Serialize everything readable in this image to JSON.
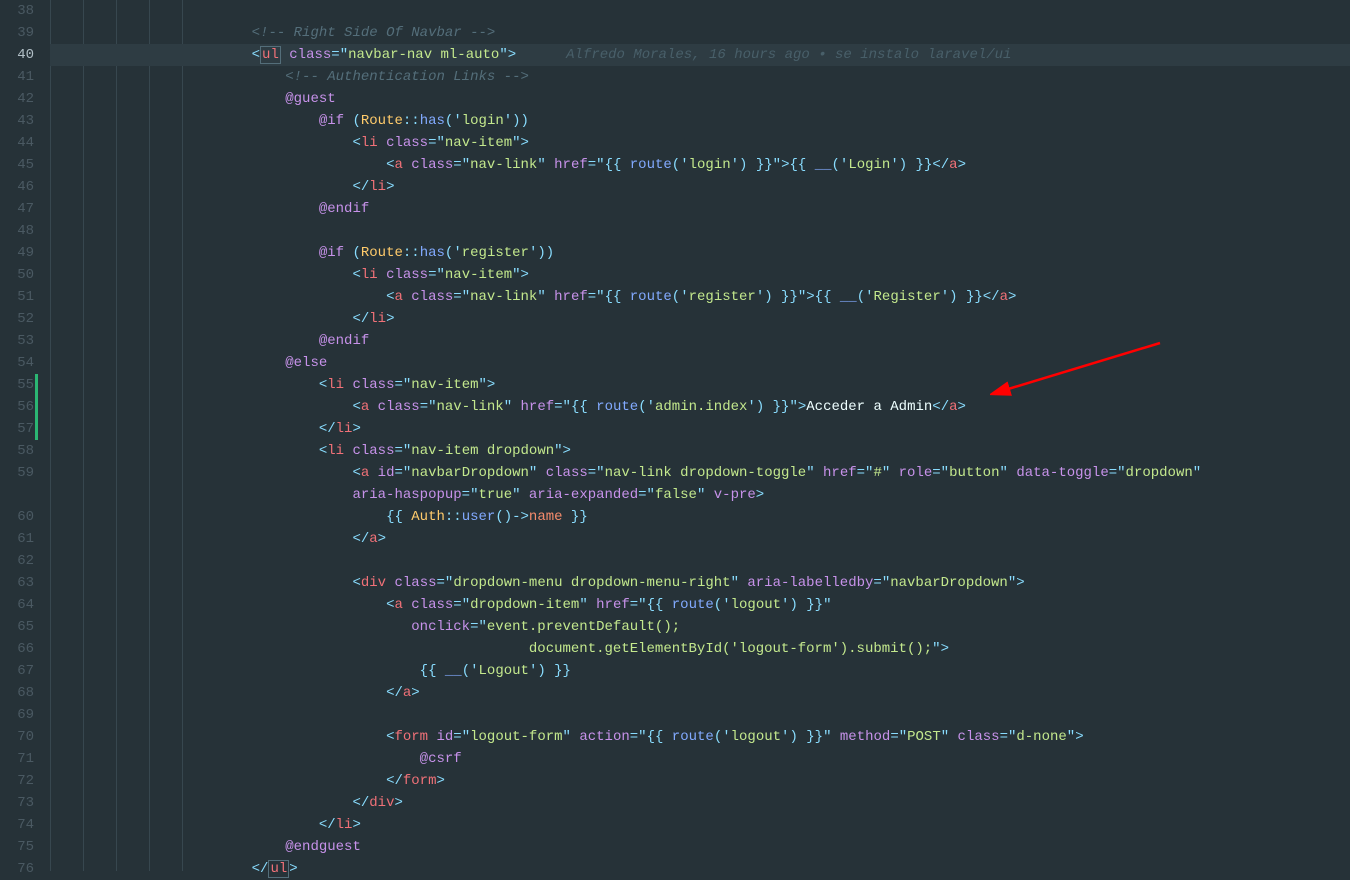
{
  "gutter": {
    "start": 38,
    "end": 76,
    "active": 40
  },
  "blame": {
    "author": "Alfredo Morales",
    "when": "16 hours ago",
    "sep": "•",
    "message": "se instalo laravel/ui"
  },
  "code": {
    "c38": "",
    "c39_comment": "<!-- Right Side Of Navbar -->",
    "c40_ul": "ul",
    "c40_class_attr": "class",
    "c40_class_val": "navbar-nav ml-auto",
    "c41_comment": "<!-- Authentication Links -->",
    "c42_guest": "@guest",
    "c43_if": "@if",
    "c43_route": "Route",
    "c43_has": "has",
    "c43_login": "login",
    "c44_li": "li",
    "c44_class": "class",
    "c44_class_val": "nav-item",
    "c45_a": "a",
    "c45_class_val": "nav-link",
    "c45_href": "href",
    "c45_route": "route",
    "c45_login_route": "login",
    "c45_login_text": "Login",
    "c46_li": "li",
    "c47_endif": "@endif",
    "c49_register": "register",
    "c51_register_route": "register",
    "c51_register_text": "Register",
    "c54_else": "@else",
    "c56_admin_route": "admin.index",
    "c56_admin_text": "Acceder a Admin",
    "c58_dropdown_class": "nav-item dropdown",
    "c59_id_val": "navbarDropdown",
    "c59_class_val": "nav-link dropdown-toggle",
    "c59_href_val": "#",
    "c59_role_val": "button",
    "c59_toggle_val": "dropdown",
    "c59x_haspopup": "true",
    "c59x_expanded": "false",
    "c60_auth": "Auth",
    "c60_user": "user",
    "c60_name": "name",
    "c63_div": "div",
    "c63_class_val": "dropdown-menu dropdown-menu-right",
    "c63_labelledby": "navbarDropdown",
    "c64_class_val": "dropdown-item",
    "c64_logout_route": "logout",
    "c65_onclick": "event.preventDefault();",
    "c66_onclick2": "document.getElementById('logout-form').submit();",
    "c67_logout_text": "Logout",
    "c70_form": "form",
    "c70_id": "logout-form",
    "c70_logout_route": "logout",
    "c70_method": "POST",
    "c70_dnone": "d-none",
    "c71_csrf": "@csrf",
    "c75_endguest": "@endguest"
  }
}
